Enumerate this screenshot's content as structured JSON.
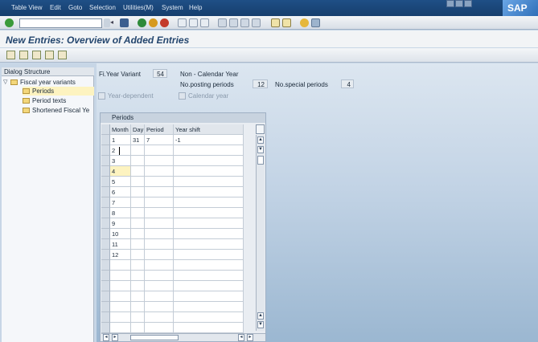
{
  "menubar": {
    "items": [
      "Table View",
      "Edit",
      "Goto",
      "Selection",
      "Utilities(M)",
      "System",
      "Help"
    ],
    "logo": "SAP"
  },
  "toolbar": {
    "command_value": "",
    "icons": [
      "enter-icon",
      "save-icon",
      "back-icon",
      "exit-icon",
      "cancel-icon",
      "print-icon",
      "find-icon",
      "find-next-icon",
      "first-page-icon",
      "prev-page-icon",
      "next-page-icon",
      "last-page-icon",
      "new-session-icon",
      "shortcut-icon",
      "help-icon",
      "settings-icon"
    ]
  },
  "title": "New Entries: Overview of Added Entries",
  "dialog": {
    "header": "Dialog Structure",
    "items": [
      {
        "label": "Fiscal year variants",
        "level": 0,
        "expanded": true
      },
      {
        "label": "Periods",
        "level": 1,
        "selected": true
      },
      {
        "label": "Period texts",
        "level": 1
      },
      {
        "label": "Shortened Fiscal Ye",
        "level": 1
      }
    ]
  },
  "header_fields": {
    "fy_variant_label": "Fi.Year Variant",
    "fy_variant_value": "54",
    "description": "Non - Calendar Year",
    "posting_periods_label": "No.posting periods",
    "posting_periods_value": "12",
    "special_periods_label": "No.special periods",
    "special_periods_value": "4",
    "year_dependent_label": "Year-dependent",
    "calendar_year_label": "Calendar year"
  },
  "periods": {
    "title": "Periods",
    "columns": [
      "Month",
      "Day",
      "Period",
      "Year shift"
    ],
    "rows": [
      [
        "1",
        "31",
        "7",
        "-1"
      ],
      [
        "2",
        "",
        "",
        ""
      ],
      [
        "3",
        "",
        "",
        ""
      ],
      [
        "4",
        "",
        "",
        ""
      ],
      [
        "5",
        "",
        "",
        ""
      ],
      [
        "6",
        "",
        "",
        ""
      ],
      [
        "7",
        "",
        "",
        ""
      ],
      [
        "8",
        "",
        "",
        ""
      ],
      [
        "9",
        "",
        "",
        ""
      ],
      [
        "10",
        "",
        "",
        ""
      ],
      [
        "11",
        "",
        "",
        ""
      ],
      [
        "12",
        "",
        "",
        ""
      ],
      [
        "",
        "",
        "",
        ""
      ],
      [
        "",
        "",
        "",
        ""
      ],
      [
        "",
        "",
        "",
        ""
      ],
      [
        "",
        "",
        "",
        ""
      ],
      [
        "",
        "",
        "",
        ""
      ],
      [
        "",
        "",
        "",
        ""
      ],
      [
        "",
        "",
        "",
        ""
      ]
    ]
  },
  "colors": {
    "title": "#24466e",
    "highlight": "#fdf3c0",
    "menubar": "#1f4f86"
  }
}
